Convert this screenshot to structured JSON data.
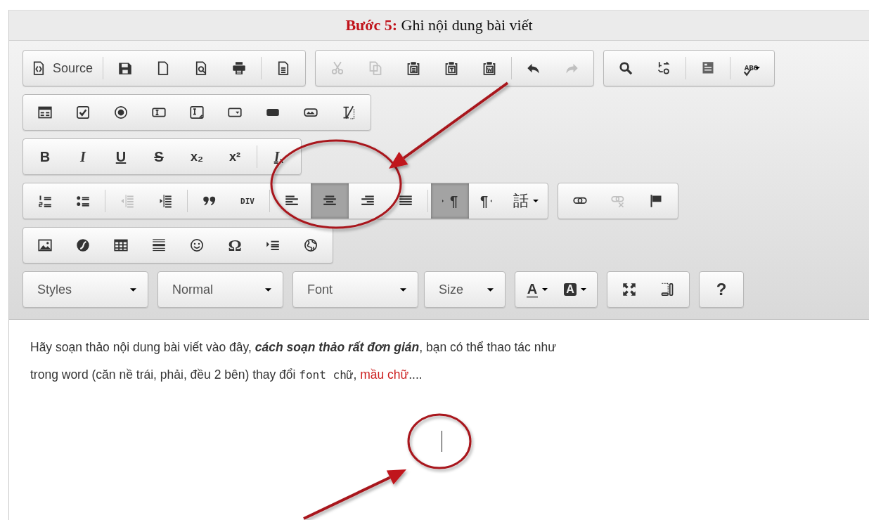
{
  "header": {
    "title": "**Bước 5:** Ghi nội dung bài viết"
  },
  "toolbar": {
    "rows": [
      {
        "groups": [
          {
            "items": [
              {
                "kind": "source",
                "label": "Source",
                "disabled": false,
                "selected": false
              },
              {
                "kind": "separator"
              },
              {
                "kind": "save",
                "disabled": false,
                "selected": false
              },
              {
                "kind": "newpage",
                "disabled": false,
                "selected": false
              },
              {
                "kind": "preview",
                "disabled": false,
                "selected": false
              },
              {
                "kind": "print",
                "disabled": false,
                "selected": false
              },
              {
                "kind": "separator"
              },
              {
                "kind": "templates",
                "disabled": false,
                "selected": false
              }
            ]
          },
          {
            "items": [
              {
                "kind": "cut",
                "disabled": true,
                "selected": false
              },
              {
                "kind": "copy",
                "disabled": true,
                "selected": false
              },
              {
                "kind": "paste",
                "disabled": false,
                "selected": false
              },
              {
                "kind": "pastetext",
                "disabled": false,
                "selected": false
              },
              {
                "kind": "pasteword",
                "disabled": false,
                "selected": false
              },
              {
                "kind": "separator"
              },
              {
                "kind": "undo",
                "disabled": false,
                "selected": false
              },
              {
                "kind": "redo",
                "disabled": true,
                "selected": false
              }
            ]
          },
          {
            "items": [
              {
                "kind": "find",
                "disabled": false,
                "selected": false
              },
              {
                "kind": "replace",
                "disabled": false,
                "selected": false
              },
              {
                "kind": "separator"
              },
              {
                "kind": "selectall",
                "disabled": false,
                "selected": false
              },
              {
                "kind": "separator"
              },
              {
                "kind": "spellcheck",
                "glyph": "ABC",
                "disabled": false,
                "selected": false
              }
            ]
          }
        ]
      },
      {
        "groups": [
          {
            "items": [
              {
                "kind": "form",
                "disabled": false,
                "selected": false
              },
              {
                "kind": "checkbox",
                "disabled": false,
                "selected": false
              },
              {
                "kind": "radio",
                "disabled": false,
                "selected": false
              },
              {
                "kind": "textfield",
                "disabled": false,
                "selected": false
              },
              {
                "kind": "textarea",
                "disabled": false,
                "selected": false
              },
              {
                "kind": "select",
                "disabled": false,
                "selected": false
              },
              {
                "kind": "button",
                "disabled": false,
                "selected": false
              },
              {
                "kind": "imagebutton",
                "disabled": false,
                "selected": false
              },
              {
                "kind": "hiddenfield",
                "disabled": false,
                "selected": false
              }
            ]
          }
        ]
      },
      {
        "groups": [
          {
            "items": [
              {
                "kind": "bold",
                "glyph": "B",
                "disabled": false,
                "selected": false
              },
              {
                "kind": "italic",
                "glyph": "I",
                "disabled": false,
                "selected": false
              },
              {
                "kind": "underline",
                "glyph": "U",
                "disabled": false,
                "selected": false
              },
              {
                "kind": "strike",
                "glyph": "S",
                "disabled": false,
                "selected": false
              },
              {
                "kind": "subscript",
                "glyph": "x₂",
                "disabled": false,
                "selected": false
              },
              {
                "kind": "superscript",
                "glyph": "x²",
                "disabled": false,
                "selected": false
              },
              {
                "kind": "separator"
              },
              {
                "kind": "removeformat",
                "glyph": "Iₓ",
                "disabled": false,
                "selected": false
              }
            ]
          }
        ]
      },
      {
        "groups": [
          {
            "items": [
              {
                "kind": "numbered",
                "disabled": false,
                "selected": false
              },
              {
                "kind": "bulleted",
                "disabled": false,
                "selected": false
              },
              {
                "kind": "separator"
              },
              {
                "kind": "outdent",
                "disabled": true,
                "selected": false
              },
              {
                "kind": "indent",
                "disabled": false,
                "selected": false
              },
              {
                "kind": "separator"
              },
              {
                "kind": "blockquote",
                "disabled": false,
                "selected": false
              },
              {
                "kind": "div",
                "glyph": "DIV",
                "disabled": false,
                "selected": false
              },
              {
                "kind": "separator"
              },
              {
                "kind": "alignleft",
                "disabled": false,
                "selected": false
              },
              {
                "kind": "aligncenter",
                "disabled": false,
                "selected": true
              },
              {
                "kind": "alignright",
                "disabled": false,
                "selected": false
              },
              {
                "kind": "justify",
                "disabled": false,
                "selected": false
              },
              {
                "kind": "separator"
              },
              {
                "kind": "ltr",
                "glyph": "¶",
                "disabled": false,
                "selected": true
              },
              {
                "kind": "rtl",
                "glyph": "¶",
                "disabled": false,
                "selected": false
              },
              {
                "kind": "language",
                "glyph": "話",
                "disabled": false,
                "selected": false
              }
            ]
          },
          {
            "items": [
              {
                "kind": "link",
                "disabled": false,
                "selected": false
              },
              {
                "kind": "unlink",
                "disabled": true,
                "selected": false
              },
              {
                "kind": "anchor",
                "disabled": false,
                "selected": false
              }
            ]
          }
        ]
      },
      {
        "groups": [
          {
            "items": [
              {
                "kind": "image",
                "disabled": false,
                "selected": false
              },
              {
                "kind": "flash",
                "disabled": false,
                "selected": false
              },
              {
                "kind": "table",
                "disabled": false,
                "selected": false
              },
              {
                "kind": "hr",
                "disabled": false,
                "selected": false
              },
              {
                "kind": "smiley",
                "disabled": false,
                "selected": false
              },
              {
                "kind": "specialchar",
                "glyph": "Ω",
                "disabled": false,
                "selected": false
              },
              {
                "kind": "pagebreak",
                "disabled": false,
                "selected": false
              },
              {
                "kind": "iframe",
                "disabled": false,
                "selected": false
              }
            ]
          }
        ]
      },
      {
        "groups": [
          {
            "items": [
              {
                "kind": "combo",
                "label": "Styles"
              }
            ]
          },
          {
            "items": [
              {
                "kind": "combo",
                "label": "Normal"
              }
            ]
          },
          {
            "items": [
              {
                "kind": "combo",
                "label": "Font"
              }
            ]
          },
          {
            "items": [
              {
                "kind": "combo_narrow",
                "label": "Size"
              }
            ]
          },
          {
            "items": [
              {
                "kind": "textcolor",
                "glyph": "A",
                "disabled": false,
                "selected": false
              },
              {
                "kind": "bgcolor",
                "glyph": "A",
                "disabled": false,
                "selected": false
              }
            ]
          },
          {
            "items": [
              {
                "kind": "maximize",
                "disabled": false,
                "selected": false
              },
              {
                "kind": "showblocks",
                "disabled": false,
                "selected": false
              }
            ]
          },
          {
            "items": [
              {
                "kind": "help",
                "glyph": "?",
                "disabled": false,
                "selected": false
              }
            ]
          }
        ]
      }
    ]
  },
  "content": {
    "paragraph": [
      {
        "kind": "plain",
        "text": "Hãy soạn thảo nội dung bài viết vào đây, "
      },
      {
        "kind": "bold_italic",
        "text": "cách soạn thảo rất đơn gián"
      },
      {
        "kind": "plain",
        "text": ", bạn có thể thao tác như trong word (căn nề trái, phải, đều 2 bên) thay đổi "
      },
      {
        "kind": "font_changed",
        "text": "font chữ"
      },
      {
        "kind": "plain",
        "text": ", "
      },
      {
        "kind": "colored",
        "color": "#cc1f1f",
        "text": "mầu chữ"
      },
      {
        "kind": "plain",
        "text": "...."
      }
    ],
    "cursor": true
  }
}
